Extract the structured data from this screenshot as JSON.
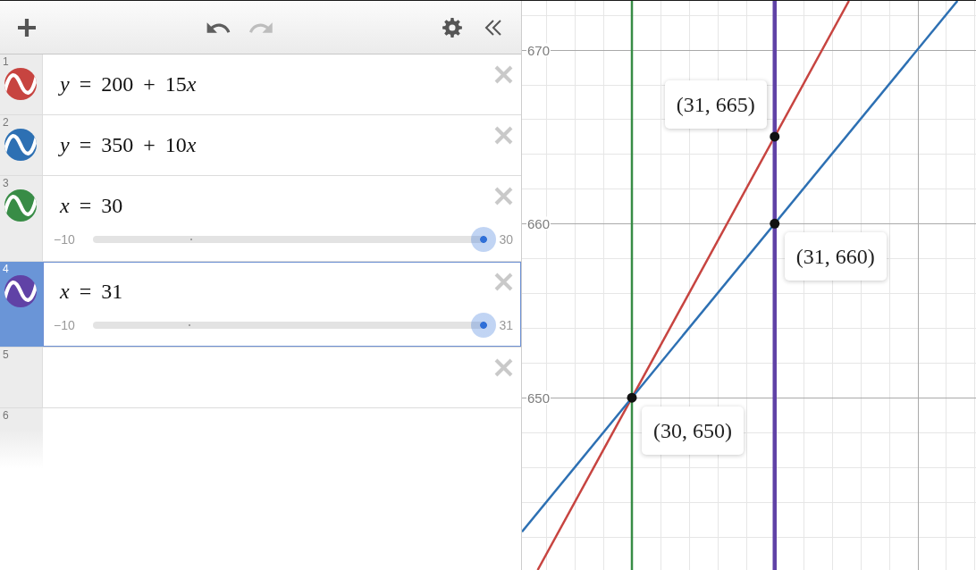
{
  "toolbar": {
    "undo": {
      "disabled": false
    },
    "redo": {
      "disabled": true
    }
  },
  "expressions": [
    {
      "number": "1",
      "kind": "expression",
      "latex": "y = 200 + 15x",
      "color": "#c74440",
      "selected": false
    },
    {
      "number": "2",
      "kind": "expression",
      "latex": "y = 350 + 10x",
      "color": "#2d70b3",
      "selected": false
    },
    {
      "number": "3",
      "kind": "slider",
      "latex": "x = 30",
      "color": "#388c46",
      "selected": false,
      "slider": {
        "min": "−10",
        "max": "30",
        "level": 1,
        "zero": {
          "level": 0.25
        }
      }
    },
    {
      "number": "4",
      "kind": "slider",
      "latex": "x = 31",
      "color": "#6042a6",
      "selected": true,
      "slider": {
        "min": "−10",
        "max": "31",
        "level": 1,
        "zero": {
          "level": 0.244
        }
      }
    },
    {
      "number": "5",
      "kind": "empty",
      "selected": false
    },
    {
      "number": "6",
      "kind": "new",
      "selected": false
    }
  ],
  "graph": {
    "y_axis_labels": [
      "670",
      "660",
      "650"
    ],
    "points": [
      {
        "label": "(31, 665)"
      },
      {
        "label": "(31, 660)"
      },
      {
        "label": "(30, 650)"
      }
    ]
  }
}
